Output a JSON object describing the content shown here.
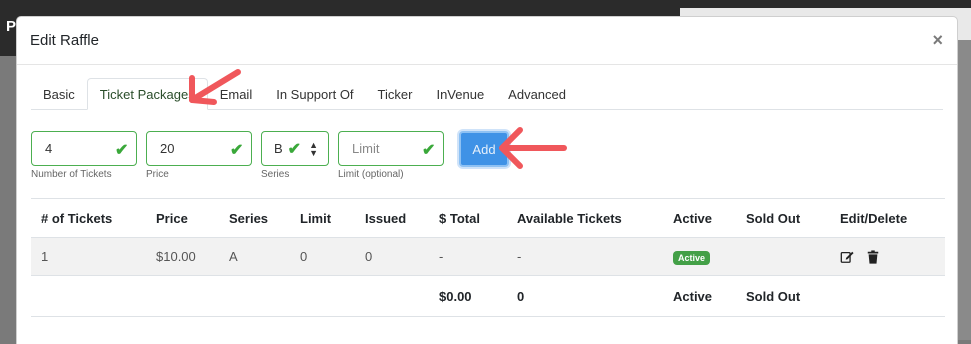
{
  "background": {
    "letter": "P"
  },
  "modal": {
    "title": "Edit Raffle",
    "close_glyph": "×"
  },
  "tabs": [
    {
      "label": "Basic"
    },
    {
      "label": "Ticket Packages"
    },
    {
      "label": "Email"
    },
    {
      "label": "In Support Of"
    },
    {
      "label": "Ticker"
    },
    {
      "label": "InVenue"
    },
    {
      "label": "Advanced"
    }
  ],
  "form": {
    "num_tickets": {
      "value": "4",
      "caption": "Number of Tickets"
    },
    "price": {
      "value": "20",
      "caption": "Price"
    },
    "series": {
      "value": "B",
      "caption": "Series"
    },
    "limit": {
      "placeholder": "Limit",
      "caption": "Limit (optional)"
    },
    "add_label": "Add"
  },
  "table": {
    "headers": [
      "# of Tickets",
      "Price",
      "Series",
      "Limit",
      "Issued",
      "$ Total",
      "Available Tickets",
      "Active",
      "Sold Out",
      "Edit/Delete"
    ],
    "row": {
      "tickets": "1",
      "price": "$10.00",
      "series": "A",
      "limit": "0",
      "issued": "0",
      "total": "-",
      "available": "-",
      "active": "Active",
      "sold_out": ""
    },
    "totals": {
      "total": "$0.00",
      "available": "0",
      "active": "Active",
      "sold_out": "Sold Out"
    }
  },
  "colors": {
    "accent_green": "#4caf50",
    "add_button": "#3f92e6",
    "annotation_arrow": "#f0575b"
  },
  "icons": {
    "check": "check-icon",
    "edit": "edit-icon",
    "delete": "trash-icon",
    "sort": "sort-icon"
  }
}
